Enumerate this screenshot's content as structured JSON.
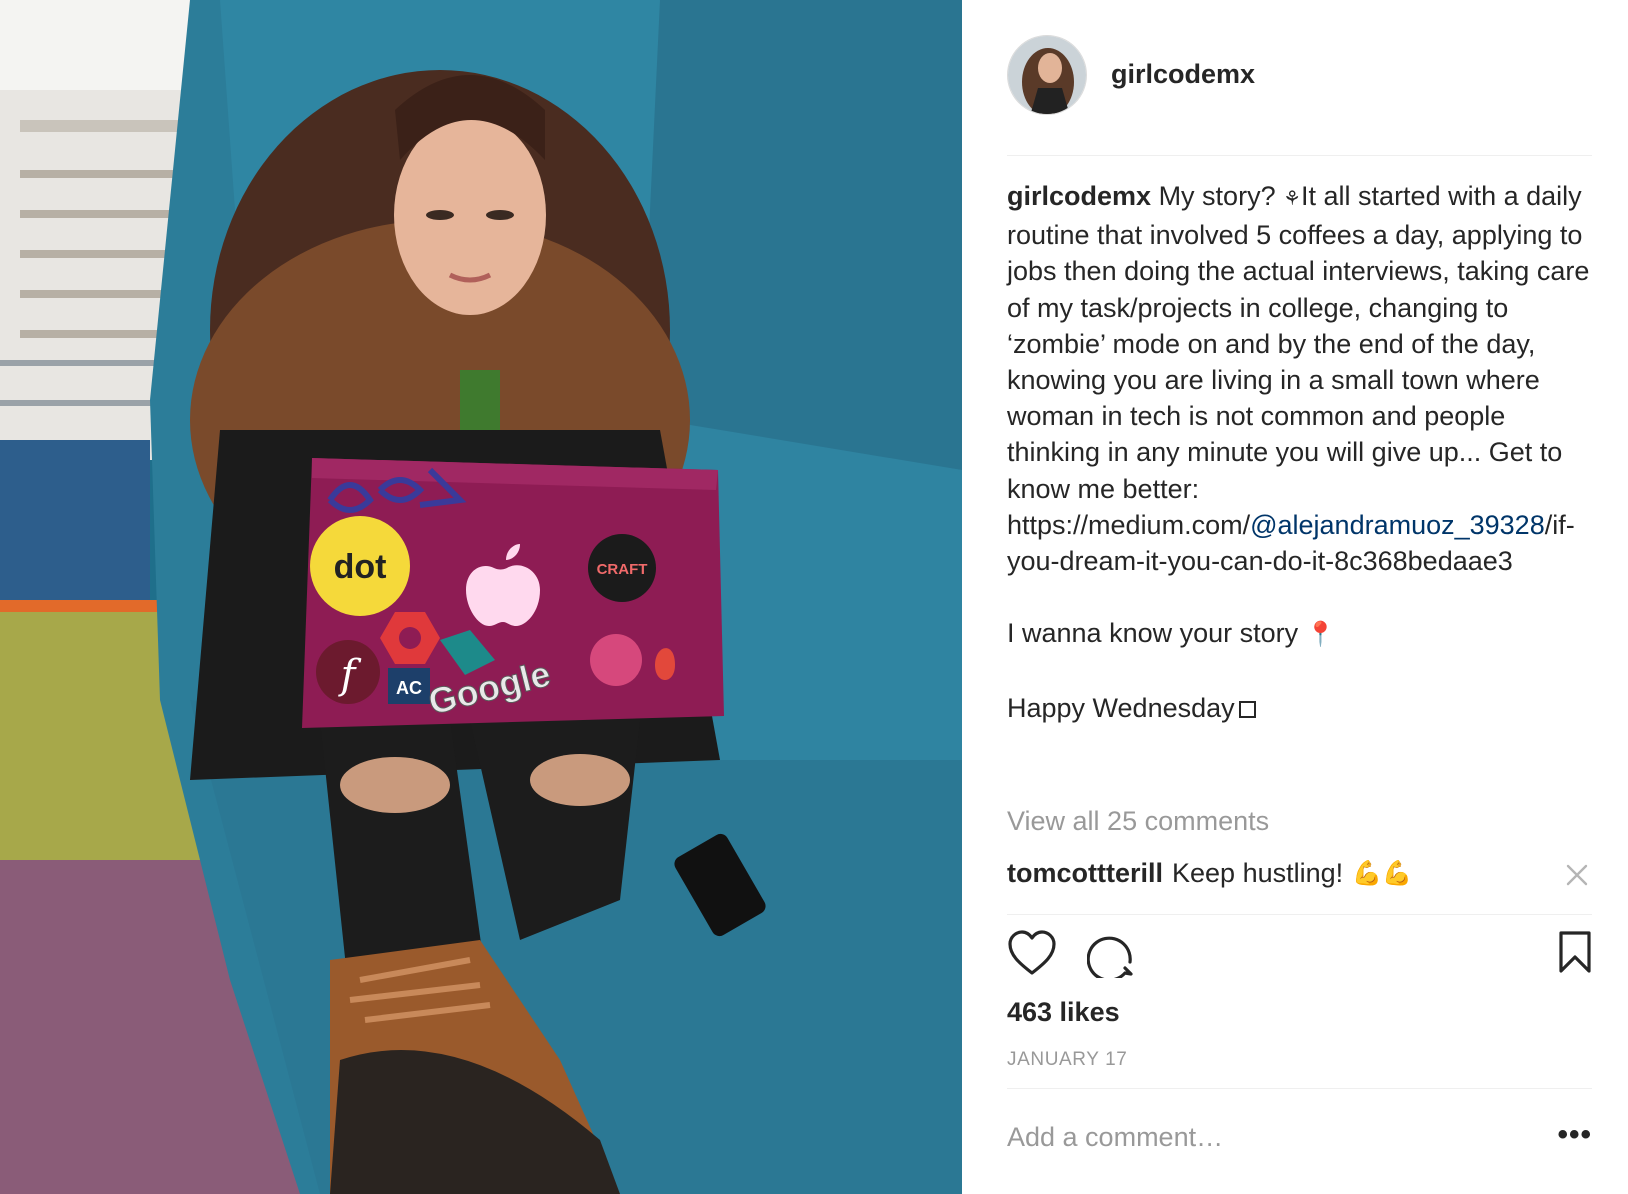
{
  "post": {
    "username": "girlcodemx",
    "avatar_icon": "profile-photo",
    "caption": {
      "username": "girlcodemx",
      "text_main": "My story? ",
      "seedling_icon": "⚘",
      "text_body": "It all started with a daily routine that involved 5 coffees a day, applying to jobs then doing the actual interviews, taking care of my task/projects in college, changing to ‘zombie’ mode on and by the end of the day, knowing you are living in a small town where woman in tech is not common and people thinking in any minute you will give up... Get to know me better: https://medium.com/",
      "link_mention": "@alejandramuoz_39328",
      "link_rest": "/if-you-dream-it-you-can-do-it-8c368bedaae3",
      "line_story": "I wanna know your story ",
      "pin_icon": "📍",
      "line_happy": "Happy Wednesday"
    },
    "view_all_comments": "View all 25 comments",
    "comment": {
      "username": "tomcottterill",
      "text": "Keep hustling!",
      "emoji": "💪💪"
    },
    "likes": "463 likes",
    "date": "JANUARY 17",
    "add_comment_placeholder": "Add a comment…",
    "more_options": "•••"
  },
  "photo": {
    "laptop_stickers": [
      "dot",
      "AC",
      "Google"
    ]
  },
  "colors": {
    "text": "#262626",
    "muted": "#999999",
    "link": "#003569",
    "divider": "#efefef",
    "chair_teal": "#2c7d99",
    "laptop_magenta": "#8e1c54"
  }
}
